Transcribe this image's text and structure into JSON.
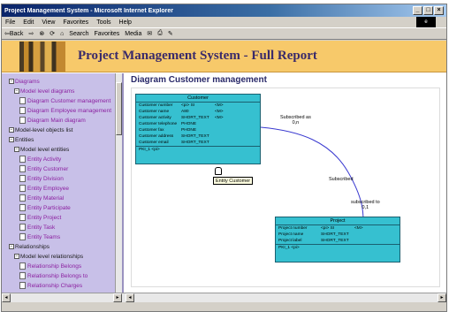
{
  "window": {
    "title": "Project Management System - Microsoft Internet Explorer",
    "buttons": [
      "_",
      "□",
      "×"
    ]
  },
  "menu": [
    "File",
    "Edit",
    "View",
    "Favorites",
    "Tools",
    "Help"
  ],
  "toolbar": [
    "⇦Back",
    "⇨",
    "⊗",
    "⟳",
    "⌂",
    "Search",
    "Favorites",
    "Media",
    "✉",
    "⎙",
    "✎"
  ],
  "banner": {
    "title": "Project Management System - Full Report"
  },
  "tree": [
    {
      "label": "Diagrams",
      "type": "folder",
      "link": true
    },
    {
      "label": "Model level diagrams",
      "type": "folder",
      "link": true
    },
    {
      "label": "Diagram Customer management",
      "type": "page",
      "link": true
    },
    {
      "label": "Diagram Employee management",
      "type": "page",
      "link": true
    },
    {
      "label": "Diagram Main diagram",
      "type": "page",
      "link": true
    },
    {
      "label": "Model-level objects list",
      "type": "folder",
      "link": false
    },
    {
      "label": "Entities",
      "type": "folder",
      "link": false
    },
    {
      "label": "Model level entities",
      "type": "folder",
      "link": false
    },
    {
      "label": "Entity Activity",
      "type": "page",
      "link": true
    },
    {
      "label": "Entity Customer",
      "type": "page",
      "link": true
    },
    {
      "label": "Entity Division",
      "type": "page",
      "link": true
    },
    {
      "label": "Entity Employee",
      "type": "page",
      "link": true
    },
    {
      "label": "Entity Material",
      "type": "page",
      "link": true
    },
    {
      "label": "Entity Participate",
      "type": "page",
      "link": true
    },
    {
      "label": "Entity Project",
      "type": "page",
      "link": true
    },
    {
      "label": "Entity Task",
      "type": "page",
      "link": true
    },
    {
      "label": "Entity Teams",
      "type": "page",
      "link": true
    },
    {
      "label": "Relationships",
      "type": "folder",
      "link": false
    },
    {
      "label": "Model level relationships",
      "type": "folder",
      "link": false
    },
    {
      "label": "Relationship Belongs",
      "type": "page",
      "link": true
    },
    {
      "label": "Relationship Belongs to",
      "type": "page",
      "link": true
    },
    {
      "label": "Relationship Charges",
      "type": "page",
      "link": true
    }
  ],
  "diagram": {
    "title": "Diagram Customer management",
    "customer": {
      "name": "Customer",
      "rows": [
        [
          "Customer number",
          "<pi> SI",
          "<M>"
        ],
        [
          "Customer name",
          "A80",
          "<M>"
        ],
        [
          "Customer activity",
          "SHORT_TEXT",
          "<M>"
        ],
        [
          "Customer telephone",
          "PHONE",
          ""
        ],
        [
          "Customer fax",
          "PHONE",
          ""
        ],
        [
          "Customer address",
          "SHORT_TEXT",
          ""
        ],
        [
          "Customer email",
          "SHORT_TEXT",
          ""
        ]
      ],
      "identifier": "PKI_1 <pi>"
    },
    "project": {
      "name": "Project",
      "rows": [
        [
          "Project number",
          "<pi> SI",
          "<M>"
        ],
        [
          "Project name",
          "SHORT_TEXT",
          ""
        ],
        [
          "Project label",
          "SHORT_TEXT",
          ""
        ]
      ],
      "identifier": "PKI_1 <pi>"
    },
    "rel_top": "Subscribed as\n0,n",
    "rel_mid": "Subscribed",
    "rel_bottom": "subscribed to\n0,1",
    "tooltip": "Entity Customer"
  }
}
